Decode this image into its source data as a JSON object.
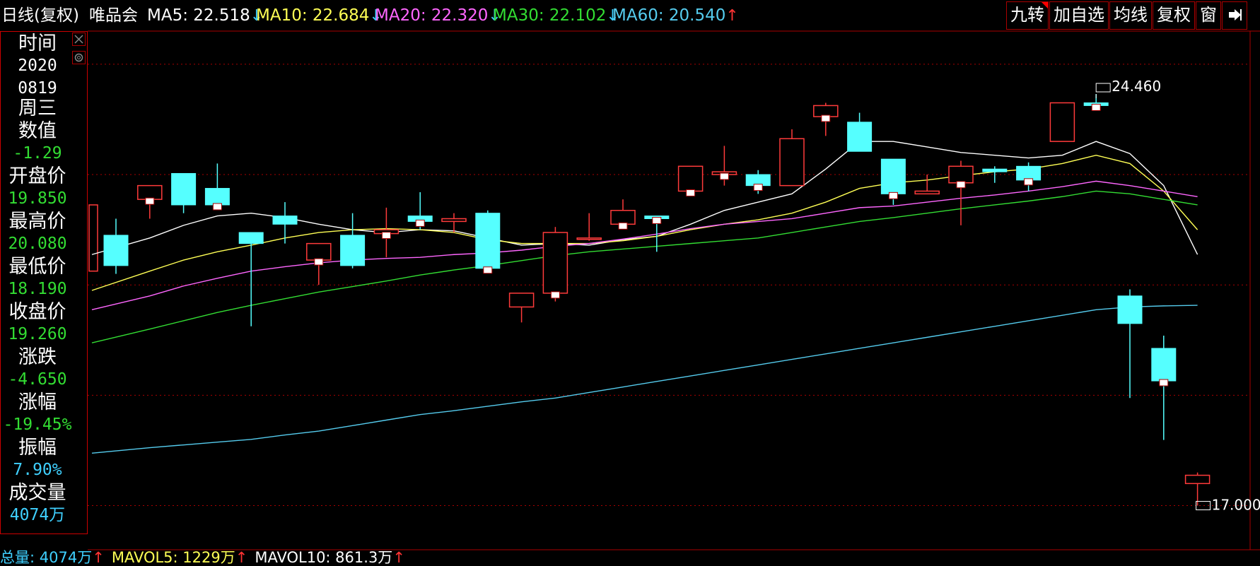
{
  "top": {
    "period": "日线(复权)",
    "stock": "唯品会",
    "ma": [
      {
        "label": "MA5: 22.518",
        "arrow": "↓",
        "color": "#ffffff",
        "arrow_color": "#3fd0ff"
      },
      {
        "label": "MA10: 22.684",
        "arrow": "↓",
        "color": "#ffff55",
        "arrow_color": "#3fd0ff"
      },
      {
        "label": "MA20: 22.320",
        "arrow": "↓",
        "color": "#ff66ff",
        "arrow_color": "#3fd0ff"
      },
      {
        "label": "MA30: 22.102",
        "arrow": "↓",
        "color": "#33dd33",
        "arrow_color": "#3fd0ff"
      },
      {
        "label": "MA60: 20.540",
        "arrow": "↑",
        "color": "#55ccee",
        "arrow_color": "#ff3333"
      }
    ],
    "buttons": [
      "九转",
      "加自选",
      "均线",
      "复权",
      "窗"
    ]
  },
  "panel": {
    "rows": [
      {
        "label": "时间",
        "value": "2020",
        "value2": "0819",
        "value3": "周三",
        "vcolor": "#ffffff"
      },
      {
        "label": "数值",
        "value": "-1.29",
        "vcolor": "#33dd33"
      },
      {
        "label": "开盘价",
        "value": "19.850",
        "vcolor": "#33dd33"
      },
      {
        "label": "最高价",
        "value": "20.080",
        "vcolor": "#33dd33"
      },
      {
        "label": "最低价",
        "value": "18.190",
        "vcolor": "#33dd33"
      },
      {
        "label": "收盘价",
        "value": "19.260",
        "vcolor": "#33dd33"
      },
      {
        "label": "涨跌",
        "value": "-4.650",
        "vcolor": "#33dd33"
      },
      {
        "label": "涨幅",
        "value": "-19.45%",
        "vcolor": "#33dd33"
      },
      {
        "label": "振幅",
        "value": "7.90%",
        "vcolor": "#3fd0ff"
      },
      {
        "label": "成交量",
        "value": "4074万",
        "vcolor": "#3fd0ff"
      }
    ]
  },
  "bottom": {
    "items": [
      {
        "label": "总量: 4074万",
        "arrow": "↑",
        "color": "#3fd0ff"
      },
      {
        "label": "MAVOL5: 1229万",
        "arrow": "↑",
        "color": "#ffff55"
      },
      {
        "label": "MAVOL10: 861.3万",
        "arrow": "↑",
        "color": "#ffffff"
      }
    ]
  },
  "colors": {
    "up": "#ff3b3b",
    "down": "#55ffff",
    "grid": "#aa0000",
    "ma5": "#ffffff",
    "ma10": "#ffff55",
    "ma20": "#ff66ff",
    "ma30": "#33dd33",
    "ma60": "#55ccee"
  },
  "chart_data": {
    "type": "candlestick",
    "annotations": [
      {
        "text": "24.460",
        "kind": "max"
      },
      {
        "text": "17.000",
        "kind": "min"
      }
    ],
    "ylim": [
      16.2,
      25.6
    ],
    "candles": [
      {
        "o": 21.9,
        "h": 22.2,
        "l": 21.2,
        "c": 21.35
      },
      {
        "o": 22.55,
        "h": 22.8,
        "l": 22.2,
        "c": 22.8
      },
      {
        "o": 23.02,
        "h": 23.02,
        "l": 22.3,
        "c": 22.45
      },
      {
        "o": 22.75,
        "h": 23.2,
        "l": 22.45,
        "c": 22.45
      },
      {
        "o": 21.95,
        "h": 21.95,
        "l": 20.25,
        "c": 21.75
      },
      {
        "o": 22.25,
        "h": 22.5,
        "l": 21.75,
        "c": 22.1
      },
      {
        "o": 21.45,
        "h": 21.7,
        "l": 21.0,
        "c": 21.75
      },
      {
        "o": 21.9,
        "h": 22.3,
        "l": 21.3,
        "c": 21.35
      },
      {
        "o": 21.93,
        "h": 22.4,
        "l": 21.5,
        "c": 22.0
      },
      {
        "o": 22.25,
        "h": 22.68,
        "l": 22.0,
        "c": 22.15
      },
      {
        "o": 22.15,
        "h": 22.3,
        "l": 21.95,
        "c": 22.2
      },
      {
        "o": 22.3,
        "h": 22.35,
        "l": 21.25,
        "c": 21.3
      },
      {
        "o": 20.6,
        "h": 20.8,
        "l": 20.32,
        "c": 20.85
      },
      {
        "o": 20.85,
        "h": 22.05,
        "l": 20.7,
        "c": 21.95
      },
      {
        "o": 21.85,
        "h": 22.3,
        "l": 21.8,
        "c": 21.85
      },
      {
        "o": 22.1,
        "h": 22.55,
        "l": 22.1,
        "c": 22.35
      },
      {
        "o": 22.25,
        "h": 22.25,
        "l": 21.6,
        "c": 22.2
      },
      {
        "o": 22.7,
        "h": 23.15,
        "l": 22.7,
        "c": 23.15
      },
      {
        "o": 23.0,
        "h": 23.52,
        "l": 22.8,
        "c": 23.05
      },
      {
        "o": 23.0,
        "h": 23.08,
        "l": 22.65,
        "c": 22.8
      },
      {
        "o": 22.8,
        "h": 23.82,
        "l": 22.8,
        "c": 23.65
      },
      {
        "o": 24.05,
        "h": 24.3,
        "l": 23.7,
        "c": 24.25
      },
      {
        "o": 23.95,
        "h": 24.12,
        "l": 23.42,
        "c": 23.42
      },
      {
        "o": 23.28,
        "h": 23.28,
        "l": 22.45,
        "c": 22.65
      },
      {
        "o": 22.65,
        "h": 23.0,
        "l": 22.65,
        "c": 22.7
      },
      {
        "o": 22.85,
        "h": 23.25,
        "l": 22.08,
        "c": 23.15
      },
      {
        "o": 23.1,
        "h": 23.15,
        "l": 22.85,
        "c": 23.05
      },
      {
        "o": 23.15,
        "h": 23.22,
        "l": 22.7,
        "c": 22.9
      },
      {
        "o": 23.6,
        "h": 24.3,
        "l": 23.6,
        "c": 24.3
      },
      {
        "o": 24.3,
        "h": 24.46,
        "l": 24.2,
        "c": 24.25
      },
      {
        "o": 20.8,
        "h": 20.92,
        "l": 18.95,
        "c": 20.3
      },
      {
        "o": 19.85,
        "h": 20.08,
        "l": 18.19,
        "c": 19.26
      },
      {
        "o": 17.4,
        "h": 17.6,
        "l": 17.0,
        "c": 17.55
      }
    ],
    "ma_series": [
      {
        "name": "MA5",
        "values": [
          21.55,
          21.85,
          22.08,
          22.25,
          22.3,
          22.22,
          22.1,
          22.0,
          21.95,
          22.0,
          21.98,
          21.85,
          21.72,
          21.75,
          21.72,
          21.82,
          21.88,
          22.1,
          22.35,
          22.5,
          22.65,
          23.1,
          23.6,
          23.6,
          23.5,
          23.4,
          23.35,
          23.3,
          23.35,
          23.6,
          23.38,
          22.8,
          21.55
        ]
      },
      {
        "name": "MA10",
        "values": [
          20.9,
          21.25,
          21.45,
          21.6,
          21.72,
          21.85,
          21.95,
          22.0,
          22.02,
          22.0,
          21.95,
          21.82,
          21.75,
          21.75,
          21.75,
          21.8,
          21.88,
          22.0,
          22.1,
          22.18,
          22.3,
          22.5,
          22.75,
          22.85,
          22.9,
          22.98,
          23.05,
          23.1,
          23.2,
          23.35,
          23.2,
          22.7,
          22.0
        ]
      },
      {
        "name": "MA20",
        "values": [
          20.55,
          20.8,
          20.98,
          21.12,
          21.25,
          21.33,
          21.4,
          21.45,
          21.48,
          21.5,
          21.55,
          21.58,
          21.63,
          21.7,
          21.75,
          21.83,
          21.92,
          22.02,
          22.1,
          22.15,
          22.2,
          22.3,
          22.4,
          22.43,
          22.5,
          22.57,
          22.63,
          22.7,
          22.78,
          22.88,
          22.8,
          22.7,
          22.6
        ]
      },
      {
        "name": "MA30",
        "values": [
          19.95,
          20.2,
          20.35,
          20.5,
          20.63,
          20.75,
          20.87,
          20.97,
          21.07,
          21.18,
          21.27,
          21.35,
          21.44,
          21.53,
          21.6,
          21.65,
          21.7,
          21.75,
          21.8,
          21.85,
          21.95,
          22.05,
          22.15,
          22.22,
          22.3,
          22.38,
          22.45,
          22.52,
          22.6,
          22.7,
          22.65,
          22.55,
          22.45
        ]
      },
      {
        "name": "MA60",
        "values": [
          17.95,
          18.05,
          18.1,
          18.15,
          18.2,
          18.28,
          18.35,
          18.45,
          18.55,
          18.65,
          18.72,
          18.8,
          18.88,
          18.95,
          19.05,
          19.15,
          19.25,
          19.35,
          19.45,
          19.55,
          19.65,
          19.75,
          19.85,
          19.95,
          20.05,
          20.15,
          20.25,
          20.35,
          20.45,
          20.55,
          20.6,
          20.62,
          20.63
        ]
      }
    ]
  }
}
